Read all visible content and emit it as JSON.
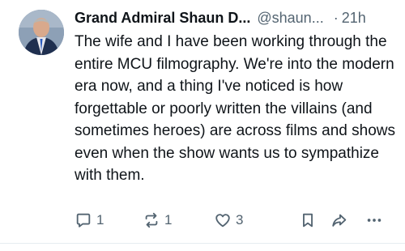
{
  "post": {
    "author": {
      "display_name": "Grand Admiral Shaun D...",
      "handle": "@shaun...",
      "separator": "·",
      "time": "21h"
    },
    "text": "The wife and I have been working through the entire MCU filmography. We're into the modern era now, and a thing I've noticed is how forgettable or poorly written the villains (and sometimes heroes) are across films and shows even when the show wants us to sympathize with them.",
    "actions": {
      "reply": {
        "icon": "reply-icon",
        "count": "1"
      },
      "repost": {
        "icon": "repost-icon",
        "count": "1"
      },
      "like": {
        "icon": "heart-icon",
        "count": "3"
      },
      "bookmark": {
        "icon": "bookmark-icon"
      },
      "share": {
        "icon": "share-icon"
      },
      "more": {
        "icon": "more-icon"
      }
    }
  },
  "colors": {
    "text": "#0f1419",
    "muted": "#536471",
    "divider": "#e6ecf0"
  }
}
